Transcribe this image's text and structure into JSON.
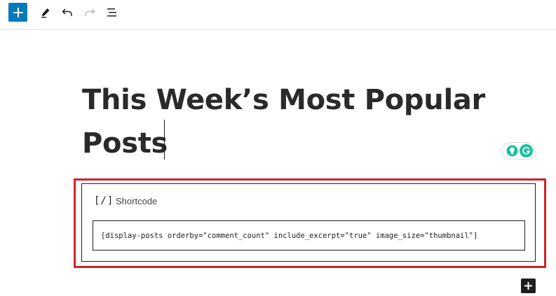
{
  "toolbar": {
    "add_icon": "plus-icon",
    "edit_icon": "pencil-icon",
    "undo_icon": "undo-icon",
    "redo_icon": "redo-icon",
    "outline_icon": "list-view-icon"
  },
  "post": {
    "title": "This Week’s Most Popular Posts"
  },
  "grammarly": {
    "bulb_icon": "lightbulb-icon",
    "logo_icon": "grammarly-g-icon",
    "logo_letter": "G"
  },
  "shortcode_block": {
    "icon_text": "[/]",
    "label": "Shortcode",
    "value": "[display-posts orderby=\"comment_count\" include_excerpt=\"true\" image_size=\"thumbnail\"]"
  },
  "colors": {
    "accent": "#007cba",
    "highlight": "#d0222b",
    "grammarly": "#15c39a",
    "text": "#1e1e1e"
  }
}
